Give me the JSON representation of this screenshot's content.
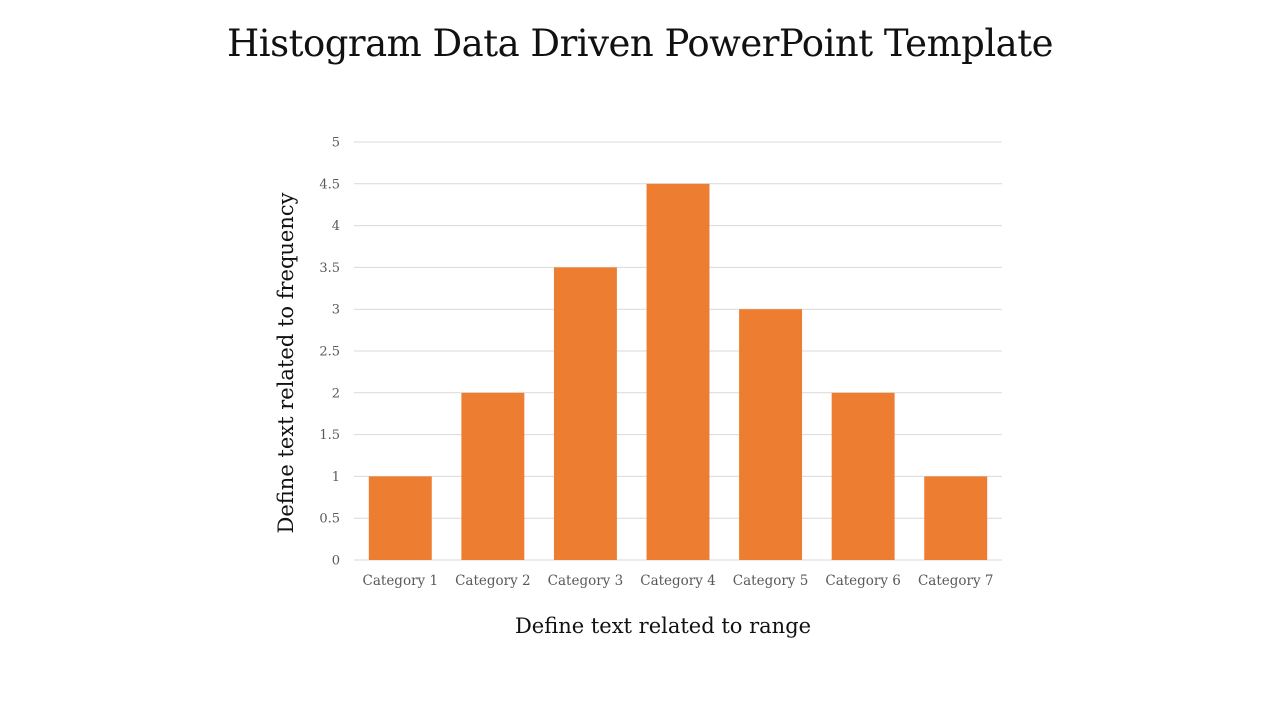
{
  "title": "Histogram Data Driven PowerPoint Template",
  "chart_data": {
    "type": "bar",
    "title": "Histogram Data Driven PowerPoint Template",
    "categories": [
      "Category 1",
      "Category 2",
      "Category 3",
      "Category 4",
      "Category 5",
      "Category 6",
      "Category 7"
    ],
    "values": [
      1,
      2,
      3.5,
      4.5,
      3,
      2,
      1
    ],
    "xlabel": "Define text related to range",
    "ylabel": "Define text related to frequency",
    "ylim": [
      0,
      5
    ],
    "yticks": [
      "0",
      "0.5",
      "1",
      "1.5",
      "2",
      "2.5",
      "3",
      "3.5",
      "4",
      "4.5",
      "5"
    ],
    "grid": true,
    "legend": "none",
    "bar_color": "#ED7D31",
    "grid_color": "#D9D9D9"
  }
}
